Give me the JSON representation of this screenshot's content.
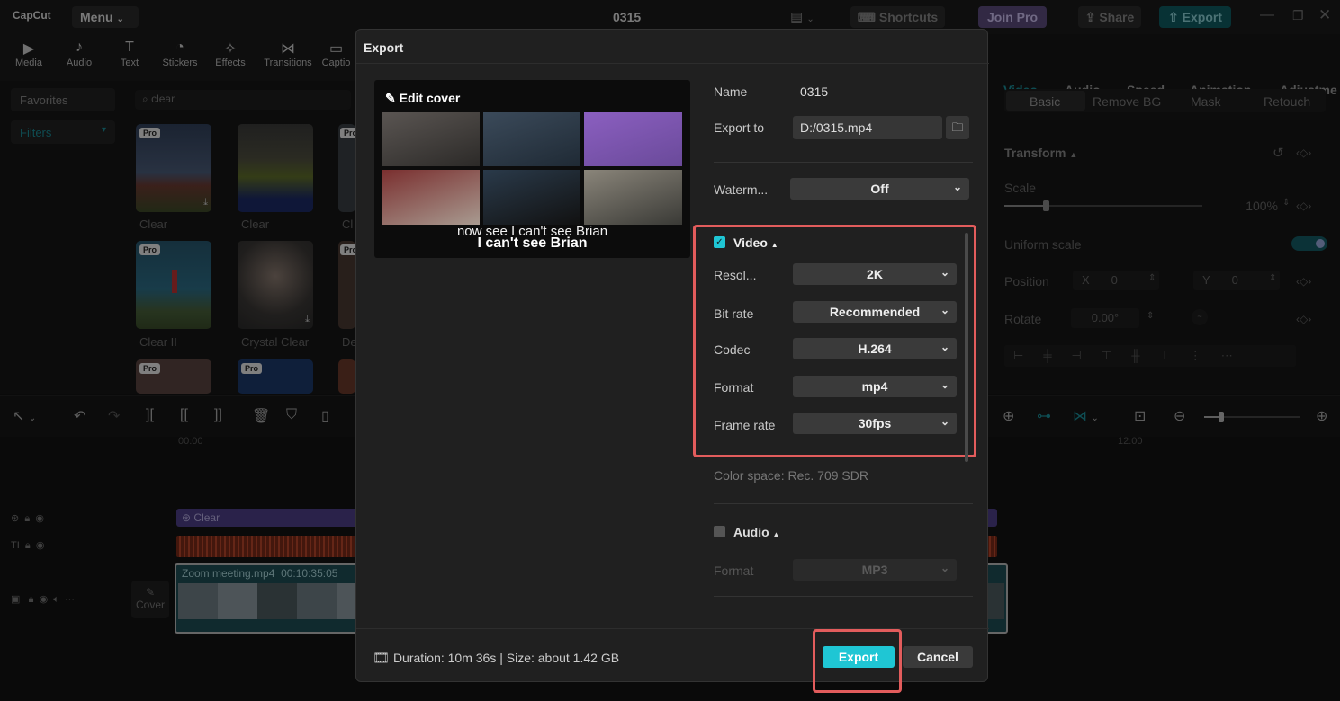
{
  "app": {
    "logo_text": "CapCut",
    "menu_label": "Menu",
    "project_title": "0315",
    "shortcuts_label": "Shortcuts",
    "join_pro_label": "Join Pro",
    "share_label": "Share",
    "export_label": "Export"
  },
  "toolbar": [
    "Media",
    "Audio",
    "Text",
    "Stickers",
    "Effects",
    "Transitions",
    "Captio"
  ],
  "left_panel": {
    "favorites_label": "Favorites",
    "filters_label": "Filters",
    "search_value": "clear"
  },
  "filters_grid": [
    {
      "name": "Clear",
      "pro": "Pro"
    },
    {
      "name": "Clear",
      "pro": ""
    },
    {
      "name": "Cl",
      "pro": "Pro"
    },
    {
      "name": "Clear II",
      "pro": "Pro"
    },
    {
      "name": "Crystal Clear",
      "pro": ""
    },
    {
      "name": "De",
      "pro": "Pro"
    },
    {
      "name": "",
      "pro": "Pro"
    },
    {
      "name": "",
      "pro": "Pro"
    }
  ],
  "right_panel": {
    "tabs": [
      "Video",
      "Audio",
      "Speed",
      "Animation",
      "Adjustme"
    ],
    "subtabs": [
      "Basic",
      "Remove BG",
      "Mask",
      "Retouch"
    ],
    "transform_label": "Transform",
    "scale_label": "Scale",
    "scale_value": "100%",
    "uniform_scale_label": "Uniform scale",
    "position_label": "Position",
    "pos_x_label": "X",
    "pos_x_value": "0",
    "pos_y_label": "Y",
    "pos_y_value": "0",
    "rotate_label": "Rotate",
    "rotate_value": "0.00°"
  },
  "timeline": {
    "time_start": "00:00",
    "time_mark": "12:00",
    "clear_clip_label": "Clear",
    "video_clip_name": "Zoom meeting.mp4",
    "video_clip_duration": "00:10:35:05",
    "cover_label": "Cover"
  },
  "export_dialog": {
    "title": "Export",
    "edit_cover_label": "Edit cover",
    "preview_caption_1": "now see I can't see Brian",
    "preview_caption_2": "I can't see Brian",
    "name_label": "Name",
    "name_value": "0315",
    "export_to_label": "Export to",
    "export_to_value": "D:/0315.mp4",
    "watermark_label": "Waterm...",
    "watermark_value": "Off",
    "video_section_label": "Video",
    "video_checked": true,
    "resolution_label": "Resol...",
    "resolution_value": "2K",
    "bitrate_label": "Bit rate",
    "bitrate_value": "Recommended",
    "codec_label": "Codec",
    "codec_value": "H.264",
    "format_label": "Format",
    "format_value": "mp4",
    "framerate_label": "Frame rate",
    "framerate_value": "30fps",
    "color_space_text": "Color space: Rec. 709 SDR",
    "audio_section_label": "Audio",
    "audio_checked": false,
    "audio_format_label": "Format",
    "audio_format_value": "MP3",
    "footer_info": "Duration: 10m 36s | Size: about 1.42 GB",
    "export_button": "Export",
    "cancel_button": "Cancel"
  },
  "colors": {
    "accent": "#1fc6d4",
    "highlight": "#e25c5c",
    "pro": "#d9c8ff"
  }
}
